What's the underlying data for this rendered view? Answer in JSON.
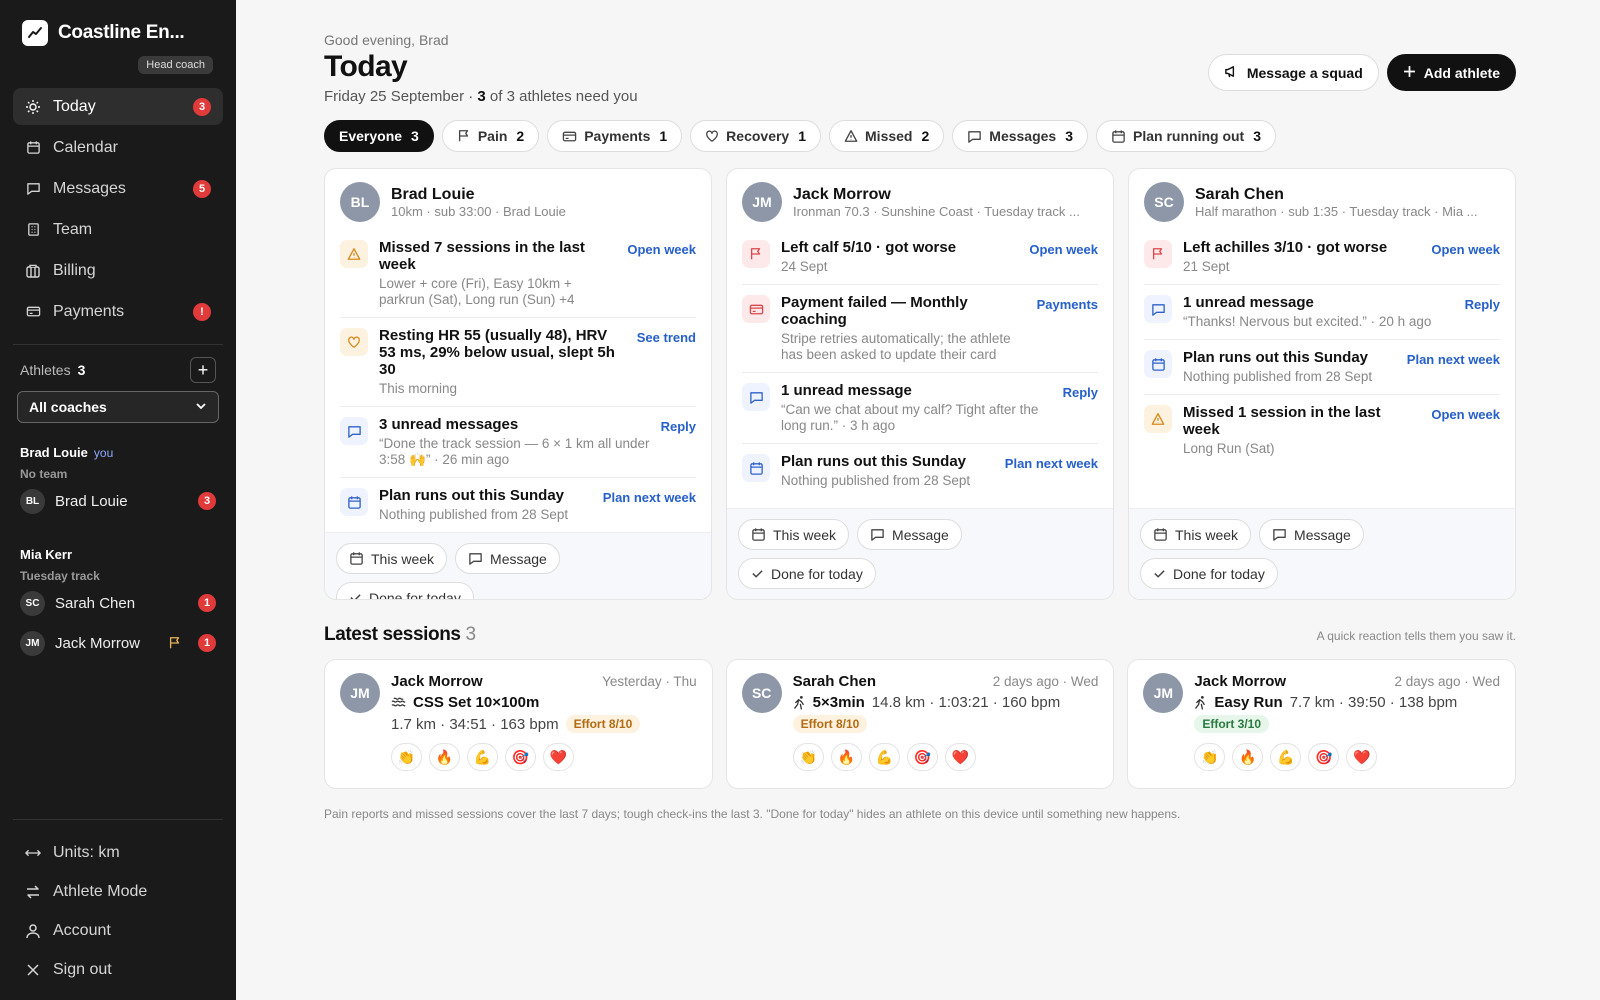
{
  "brand": {
    "name": "Coastline En...",
    "role": "Head coach"
  },
  "nav": [
    {
      "label": "Today",
      "badge": "3",
      "icon": "sun-icon"
    },
    {
      "label": "Calendar",
      "badge": "",
      "icon": "calendar-icon"
    },
    {
      "label": "Messages",
      "badge": "5",
      "icon": "message-icon"
    },
    {
      "label": "Team",
      "badge": "",
      "icon": "building-icon"
    },
    {
      "label": "Billing",
      "badge": "",
      "icon": "billing-icon"
    },
    {
      "label": "Payments",
      "badge": "!",
      "icon": "card-icon"
    }
  ],
  "athletes": {
    "label": "Athletes",
    "count": "3",
    "coach_filter": "All coaches",
    "groups": [
      {
        "title": "Brad Louie",
        "you": "you",
        "sub": "No team",
        "members": [
          {
            "initials": "BL",
            "name": "Brad Louie",
            "badge": "3",
            "flag": false
          }
        ]
      },
      {
        "title": "Mia Kerr",
        "you": "",
        "sub": "Tuesday track",
        "members": [
          {
            "initials": "SC",
            "name": "Sarah Chen",
            "badge": "1",
            "flag": false
          },
          {
            "initials": "JM",
            "name": "Jack Morrow",
            "badge": "1",
            "flag": true
          }
        ]
      }
    ]
  },
  "bottom_nav": [
    {
      "label": "Units: km",
      "icon": "arrows-icon"
    },
    {
      "label": "Athlete Mode",
      "icon": "switch-icon"
    },
    {
      "label": "Account",
      "icon": "user-icon"
    },
    {
      "label": "Sign out",
      "icon": "close-icon"
    }
  ],
  "header": {
    "greeting": "Good evening, Brad",
    "title": "Today",
    "date": "Friday 25 September · ",
    "need_count": "3",
    "need_text": " of 3 athletes need you",
    "message_squad": "Message a squad",
    "add_athlete": "Add athlete"
  },
  "filters": [
    {
      "label": "Everyone",
      "count": "3",
      "icon": "",
      "active": true
    },
    {
      "label": "Pain",
      "count": "2",
      "icon": "flag-icon"
    },
    {
      "label": "Payments",
      "count": "1",
      "icon": "card-icon"
    },
    {
      "label": "Recovery",
      "count": "1",
      "icon": "heart-icon"
    },
    {
      "label": "Missed",
      "count": "2",
      "icon": "warning-icon"
    },
    {
      "label": "Messages",
      "count": "3",
      "icon": "message-icon"
    },
    {
      "label": "Plan running out",
      "count": "3",
      "icon": "calendar-icon"
    }
  ],
  "cards": [
    {
      "initials": "BL",
      "name": "Brad Louie",
      "sub": "10km · sub 33:00 · Brad Louie",
      "items": [
        {
          "type": "warn",
          "title": "Missed 7 sessions in the last week",
          "desc": "Lower + core (Fri), Easy 10km + parkrun (Sat), Long run (Sun) +4",
          "action": "Open week"
        },
        {
          "type": "heart",
          "title": "Resting HR 55 (usually 48), HRV 53 ms, 29% below usual, slept 5h 30",
          "desc": "This morning",
          "action": "See trend"
        },
        {
          "type": "msg",
          "title": "3 unread messages",
          "desc": "“Done the track session — 6 × 1 km all under 3:58 🙌” · 26 min ago",
          "action": "Reply"
        },
        {
          "type": "cal",
          "title": "Plan runs out this Sunday",
          "desc": "Nothing published from 28 Sept",
          "action": "Plan next week"
        }
      ],
      "actions": {
        "week": "This week",
        "message": "Message",
        "done": "Done for today"
      }
    },
    {
      "initials": "JM",
      "name": "Jack Morrow",
      "sub": "Ironman 70.3 · Sunshine Coast · Tuesday track ...",
      "items": [
        {
          "type": "flag",
          "title": "Left calf 5/10 · got worse",
          "desc": "24 Sept",
          "action": "Open week"
        },
        {
          "type": "pay",
          "title": "Payment failed — Monthly coaching",
          "desc": "Stripe retries automatically; the athlete has been asked to update their card",
          "action": "Payments"
        },
        {
          "type": "msg",
          "title": "1 unread message",
          "desc": "“Can we chat about my calf? Tight after the long run.” · 3 h ago",
          "action": "Reply"
        },
        {
          "type": "cal",
          "title": "Plan runs out this Sunday",
          "desc": "Nothing published from 28 Sept",
          "action": "Plan next week"
        }
      ],
      "actions": {
        "week": "This week",
        "message": "Message",
        "done": "Done for today"
      }
    },
    {
      "initials": "SC",
      "name": "Sarah Chen",
      "sub": "Half marathon · sub 1:35 · Tuesday track · Mia ...",
      "items": [
        {
          "type": "flag",
          "title": "Left achilles 3/10 · got worse",
          "desc": "21 Sept",
          "action": "Open week"
        },
        {
          "type": "msg",
          "title": "1 unread message",
          "desc": "“Thanks! Nervous but excited.” · 20 h ago",
          "action": "Reply"
        },
        {
          "type": "cal",
          "title": "Plan runs out this Sunday",
          "desc": "Nothing published from 28 Sept",
          "action": "Plan next week"
        },
        {
          "type": "warn",
          "title": "Missed 1 session in the last week",
          "desc": "Long Run (Sat)",
          "action": "Open week"
        }
      ],
      "actions": {
        "week": "This week",
        "message": "Message",
        "done": "Done for today"
      }
    }
  ],
  "latest": {
    "title": "Latest sessions",
    "count": "3",
    "note": "A quick reaction tells them you saw it.",
    "sessions": [
      {
        "initials": "JM",
        "name": "Jack Morrow",
        "when": "Yesterday · Thu",
        "sport_icon": "swim-icon",
        "session": "CSS Set 10×100m",
        "stats": "1.7 km · 34:51 · 163 bpm",
        "stats_inline": false,
        "effort": "Effort 8/10",
        "effort_level": "hi"
      },
      {
        "initials": "SC",
        "name": "Sarah Chen",
        "when": "2 days ago · Wed",
        "sport_icon": "run-icon",
        "session": "5×3min",
        "stats": "14.8 km · 1:03:21 · 160 bpm",
        "stats_inline": true,
        "effort": "Effort 8/10",
        "effort_level": "hi"
      },
      {
        "initials": "JM",
        "name": "Jack Morrow",
        "when": "2 days ago · Wed",
        "sport_icon": "run-icon",
        "session": "Easy Run",
        "stats": "7.7 km · 39:50 · 138 bpm",
        "stats_inline": true,
        "effort": "Effort 3/10",
        "effort_level": "lo"
      }
    ],
    "reactions": [
      "👏",
      "🔥",
      "💪",
      "🎯",
      "❤️"
    ]
  },
  "footnote": "Pain reports and missed sessions cover the last 7 days; tough check-ins the last 3. \"Done for today\" hides an athlete on this device until something new happens."
}
